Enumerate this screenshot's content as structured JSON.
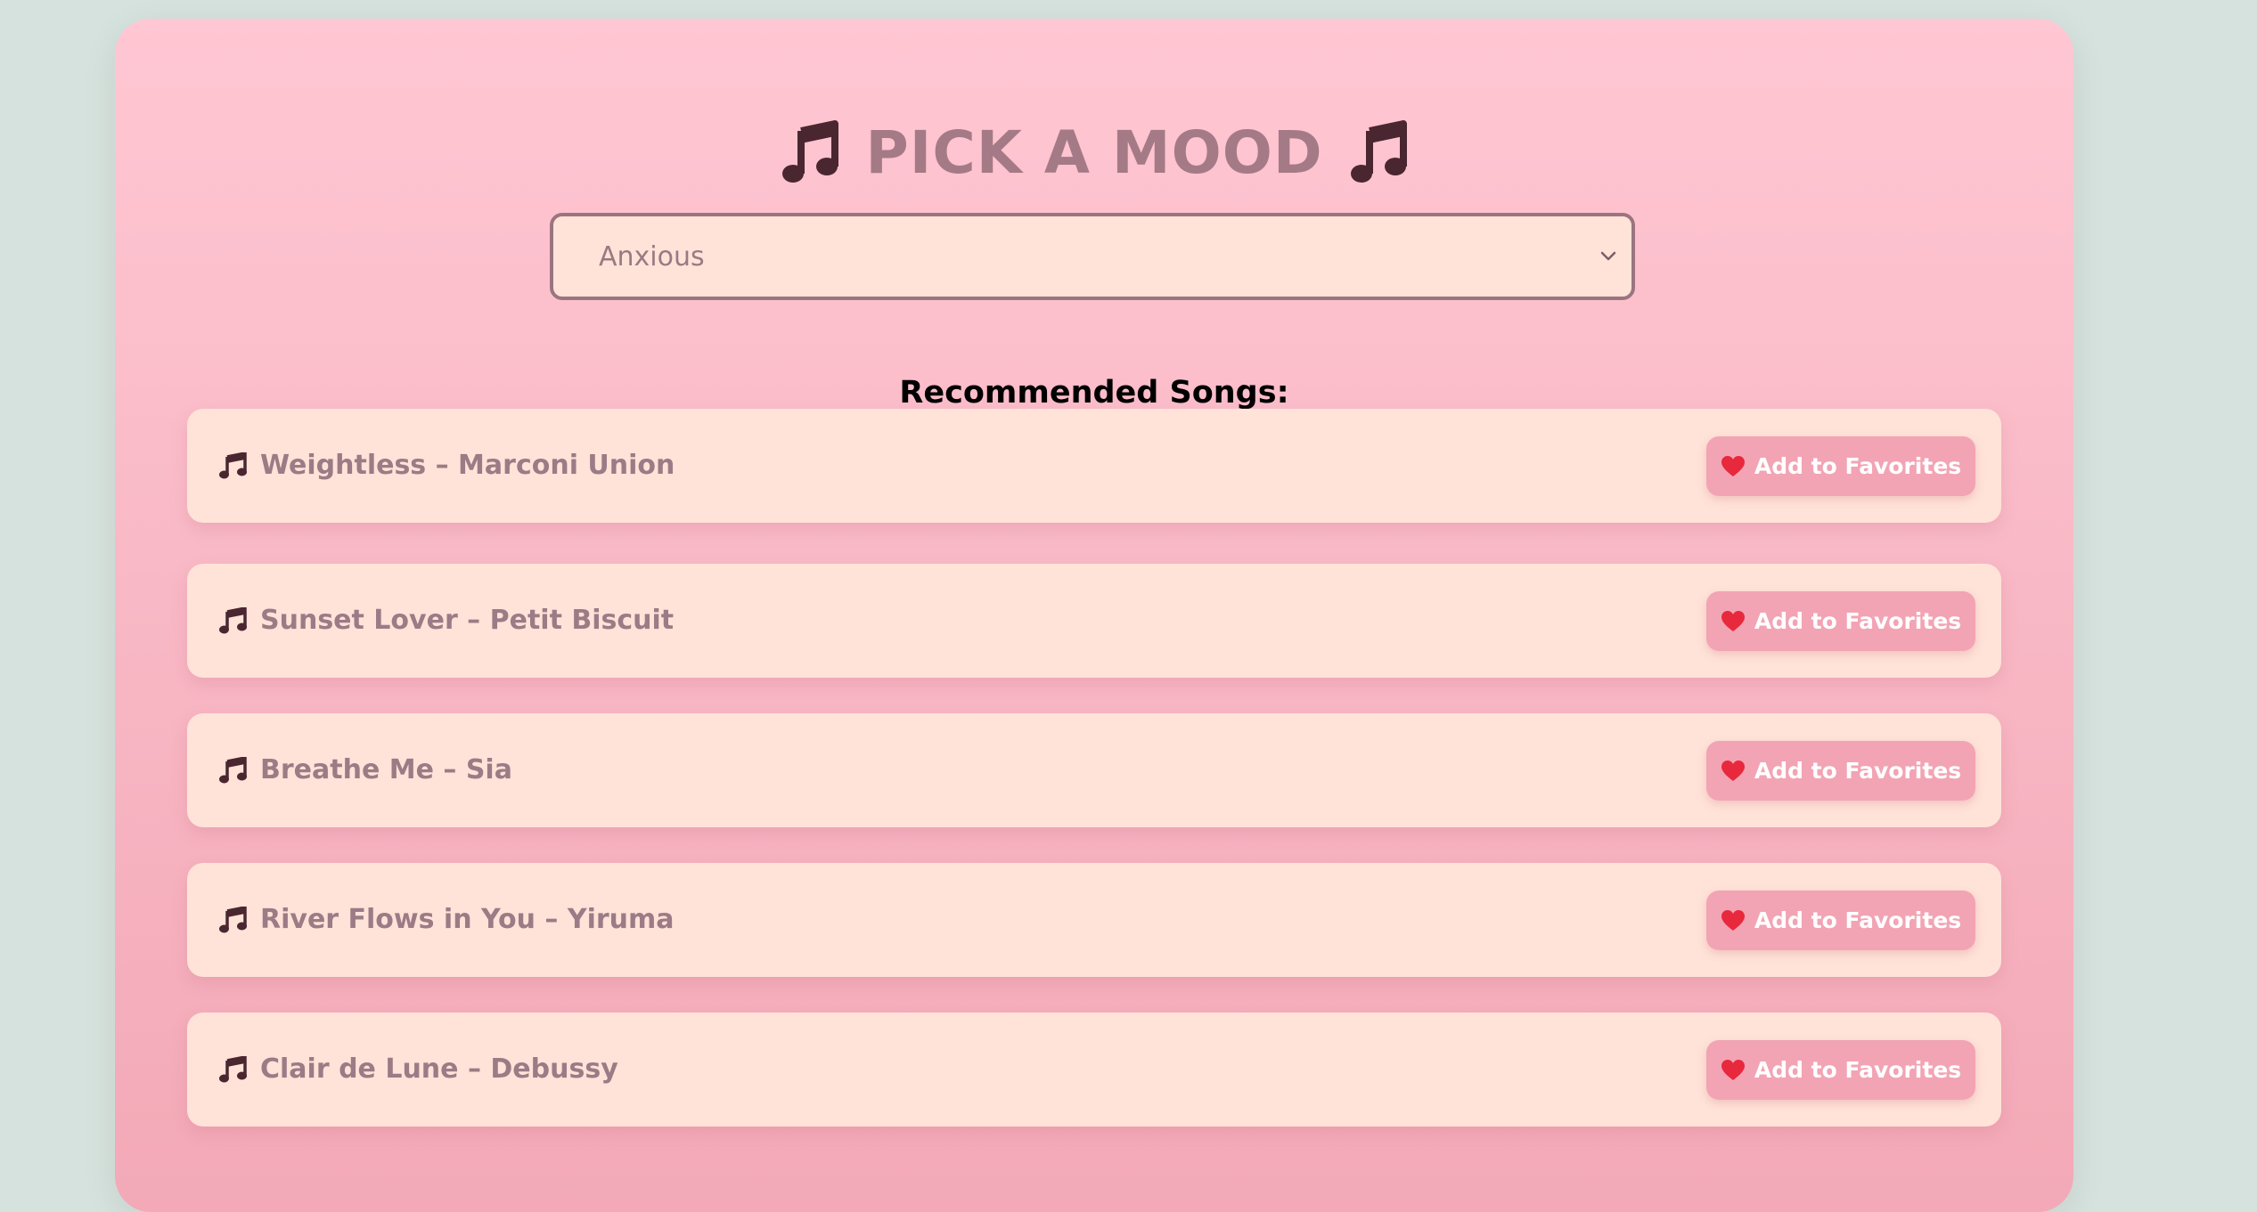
{
  "page": {
    "title": "PICK A MOOD"
  },
  "mood_select": {
    "selected_value": "Anxious"
  },
  "recommendations": {
    "heading": "Recommended Songs:",
    "songs": [
      {
        "title": "Weightless – Marconi Union",
        "button_label": "Add to Favorites"
      },
      {
        "title": "Sunset Lover – Petit Biscuit",
        "button_label": "Add to Favorites"
      },
      {
        "title": "Breathe Me – Sia",
        "button_label": "Add to Favorites"
      },
      {
        "title": "River Flows in You – Yiruma",
        "button_label": "Add to Favorites"
      },
      {
        "title": "Clair de Lune – Debussy",
        "button_label": "Add to Favorites"
      }
    ]
  },
  "icons": {
    "title_left": "music-note-icon",
    "title_right": "music-note-icon",
    "song_row": "music-notes-icon",
    "favorite": "heart-icon",
    "select_arrow": "chevron-down-icon"
  },
  "colors": {
    "page_background": "#d6e2dd",
    "card_top": "#ffc7d3",
    "card_bottom": "#f3a9b7",
    "title_text": "#a47a86",
    "select_background": "#ffe3d9",
    "select_border": "#9a7580",
    "song_row_background": "#ffe3d8",
    "song_title_text": "#9c7b86",
    "favorite_button": "#f2a4b4",
    "favorite_button_text": "#ffffff",
    "heart": "#e8283c",
    "icon_dark": "#4a2630"
  }
}
